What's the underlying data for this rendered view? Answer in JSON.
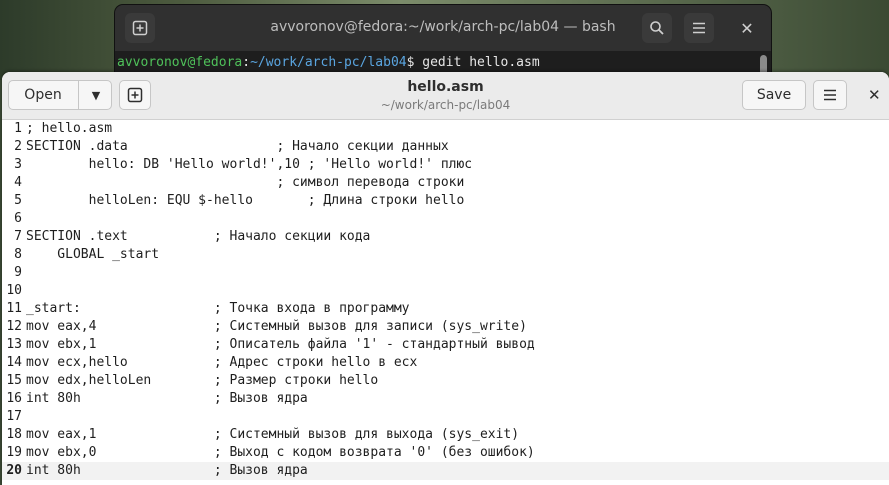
{
  "terminal": {
    "title": "avvoronov@fedora:~/work/arch-pc/lab04 — bash",
    "prompt_user": "avvoronov@fedora",
    "prompt_sep": ":",
    "prompt_path": "~/work/arch-pc/lab04",
    "prompt_symbol": "$ ",
    "command": "gedit hello.asm",
    "icons": {
      "new_tab": "new-tab-icon",
      "search": "search-icon",
      "menu": "hamburger-menu-icon",
      "close": "close-icon"
    }
  },
  "gedit": {
    "open_label": "Open",
    "save_label": "Save",
    "file_name": "hello.asm",
    "file_path": "~/work/arch-pc/lab04",
    "current_line": 20,
    "lines": [
      {
        "n": "1",
        "text": "; hello.asm"
      },
      {
        "n": "2",
        "text": "SECTION .data                   ; Начало секции данных"
      },
      {
        "n": "3",
        "text": "        hello: DB 'Hello world!',10 ; 'Hello world!' плюс"
      },
      {
        "n": "4",
        "text": "                                ; символ перевода строки"
      },
      {
        "n": "5",
        "text": "        helloLen: EQU $-hello       ; Длина строки hello"
      },
      {
        "n": "6",
        "text": ""
      },
      {
        "n": "7",
        "text": "SECTION .text           ; Начало секции кода"
      },
      {
        "n": "8",
        "text": "    GLOBAL _start"
      },
      {
        "n": "9",
        "text": ""
      },
      {
        "n": "10",
        "text": ""
      },
      {
        "n": "11",
        "text": "_start:                 ; Точка входа в программу"
      },
      {
        "n": "12",
        "text": "mov eax,4               ; Системный вызов для записи (sys_write)"
      },
      {
        "n": "13",
        "text": "mov ebx,1               ; Описатель файла '1' - стандартный вывод"
      },
      {
        "n": "14",
        "text": "mov ecx,hello           ; Адрес строки hello в ecx"
      },
      {
        "n": "15",
        "text": "mov edx,helloLen        ; Размер строки hello"
      },
      {
        "n": "16",
        "text": "int 80h                 ; Вызов ядра"
      },
      {
        "n": "17",
        "text": ""
      },
      {
        "n": "18",
        "text": "mov eax,1               ; Системный вызов для выхода (sys_exit)"
      },
      {
        "n": "19",
        "text": "mov ebx,0               ; Выход с кодом возврата '0' (без ошибок)"
      },
      {
        "n": "20",
        "text": "int 80h                 ; Вызов ядра"
      }
    ],
    "icons": {
      "open_dropdown": "chevron-down-icon",
      "new_document": "new-document-icon",
      "menu": "hamburger-menu-icon",
      "close": "close-icon"
    }
  },
  "colors": {
    "prompt_user": "#4fc15a",
    "prompt_path": "#5aa5e0",
    "terminal_bg": "#1e1e1e",
    "header_bg": "#ebebeb"
  }
}
